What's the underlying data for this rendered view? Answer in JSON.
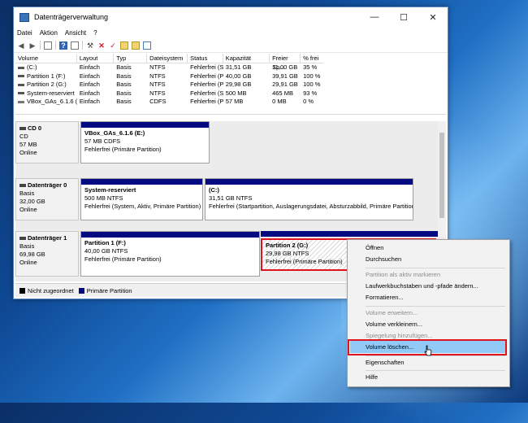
{
  "window": {
    "title": "Datenträgerverwaltung",
    "minimize": "—",
    "maximize": "☐",
    "close": "✕"
  },
  "menu": [
    "Datei",
    "Aktion",
    "Ansicht",
    "?"
  ],
  "table": {
    "headers": [
      "Volume",
      "Layout",
      "Typ",
      "Dateisystem",
      "Status",
      "Kapazität",
      "Freier Sp...",
      "% frei"
    ],
    "rows": [
      [
        "(C:)",
        "Einfach",
        "Basis",
        "NTFS",
        "Fehlerfrei (S...",
        "31,51 GB",
        "11,00 GB",
        "35 %"
      ],
      [
        "Partition 1 (F:)",
        "Einfach",
        "Basis",
        "NTFS",
        "Fehlerfrei (P...",
        "40,00 GB",
        "39,91 GB",
        "100 %"
      ],
      [
        "Partition 2 (G:)",
        "Einfach",
        "Basis",
        "NTFS",
        "Fehlerfrei (P...",
        "29,98 GB",
        "29,91 GB",
        "100 %"
      ],
      [
        "System-reserviert",
        "Einfach",
        "Basis",
        "NTFS",
        "Fehlerfrei (S...",
        "500 MB",
        "465 MB",
        "93 %"
      ],
      [
        "VBox_GAs_6.1.6 (E:)",
        "Einfach",
        "Basis",
        "CDFS",
        "Fehlerfrei (P...",
        "57 MB",
        "0 MB",
        "0 %"
      ]
    ]
  },
  "disks": [
    {
      "name": "CD 0",
      "lines": [
        "CD",
        "57 MB",
        "Online"
      ],
      "partitions": [
        {
          "title": "VBox_GAs_6.1.6  (E:)",
          "size": "57 MB CDFS",
          "status": "Fehlerfrei (Primäre Partition)"
        }
      ]
    },
    {
      "name": "Datenträger 0",
      "lines": [
        "Basis",
        "32,00 GB",
        "Online"
      ],
      "partitions": [
        {
          "title": "System-reserviert",
          "size": "500 MB NTFS",
          "status": "Fehlerfrei (System, Aktiv, Primäre Partition)"
        },
        {
          "title": "(C:)",
          "size": "31,51 GB NTFS",
          "status": "Fehlerfrei (Startpartition, Auslagerungsdatei, Absturzabbild, Primäre Partition)"
        }
      ]
    },
    {
      "name": "Datenträger 1",
      "lines": [
        "Basis",
        "69,98 GB",
        "Online"
      ],
      "partitions": [
        {
          "title": "Partition 1  (F:)",
          "size": "40,00 GB NTFS",
          "status": "Fehlerfrei (Primäre Partition)"
        },
        {
          "title": "Partition 2  (G:)",
          "size": "29,98 GB NTFS",
          "status": "Fehlerfrei (Primäre Partition)"
        }
      ]
    }
  ],
  "legend": {
    "unallocated": "Nicht zugeordnet",
    "primary": "Primäre Partition",
    "unallocated_color": "#000000",
    "primary_color": "#060a80"
  },
  "context_menu": {
    "items": [
      "Öffnen",
      "Durchsuchen",
      "Partition als aktiv markieren",
      "Laufwerkbuchstaben und -pfade ändern...",
      "Formatieren...",
      "Volume erweitern...",
      "Volume verkleinern...",
      "Spiegelung hinzufügen...",
      "Volume löschen...",
      "Eigenschaften",
      "Hilfe"
    ]
  },
  "colors": {
    "highlight": "#91c9f7",
    "selection_border": "#e0141f"
  }
}
